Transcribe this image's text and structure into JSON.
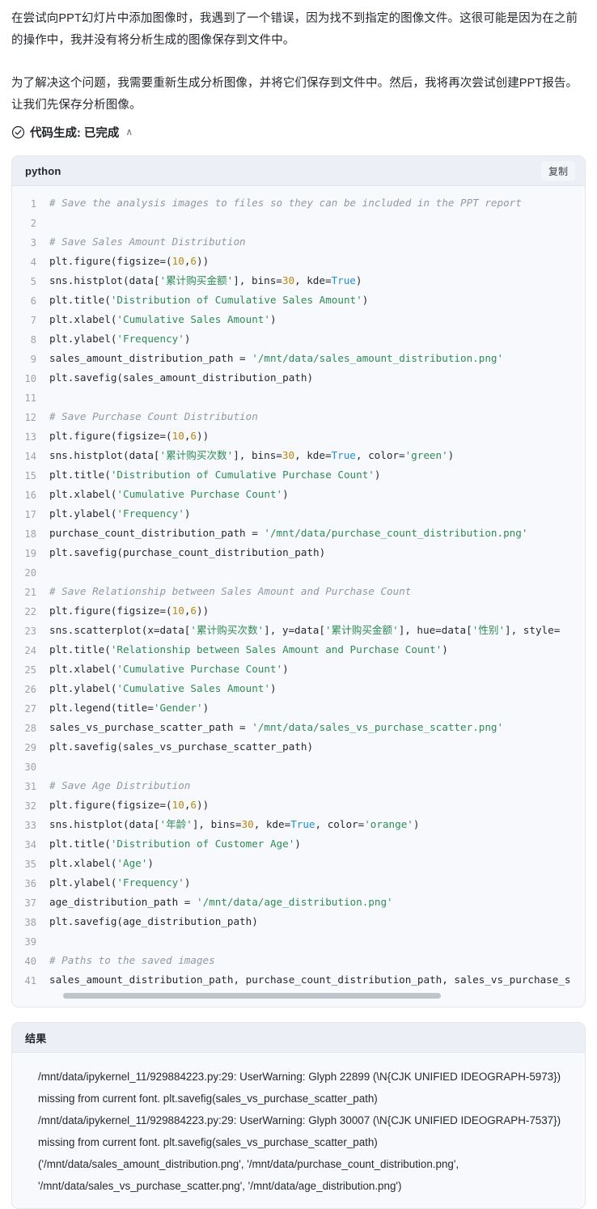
{
  "prose": {
    "paragraph_1": "在尝试向PPT幻灯片中添加图像时，我遇到了一个错误，因为找不到指定的图像文件。这很可能是因为在之前的操作中，我并没有将分析生成的图像保存到文件中。",
    "paragraph_2": "为了解决这个问题，我需要重新生成分析图像，并将它们保存到文件中。然后，我将再次尝试创建PPT报告。让我们先保存分析图像。"
  },
  "status": {
    "icon": "check-circle-icon",
    "label": "代码生成: 已完成",
    "chevron": "chevron-up-icon",
    "chevron_glyph": "∧"
  },
  "code_panel": {
    "language": "python",
    "copy_label": "复制",
    "lines": [
      {
        "n": "1",
        "tokens": [
          {
            "t": "# Save the analysis images to files so they can be included in the PPT report",
            "c": "comment"
          }
        ]
      },
      {
        "n": "2",
        "tokens": []
      },
      {
        "n": "3",
        "tokens": [
          {
            "t": "# Save Sales Amount Distribution",
            "c": "comment"
          }
        ]
      },
      {
        "n": "4",
        "tokens": [
          {
            "t": "plt.figure(figsize=(",
            "c": "plain"
          },
          {
            "t": "10",
            "c": "num"
          },
          {
            "t": ",",
            "c": "plain"
          },
          {
            "t": "6",
            "c": "num"
          },
          {
            "t": "))",
            "c": "plain"
          }
        ]
      },
      {
        "n": "5",
        "tokens": [
          {
            "t": "sns.histplot(data[",
            "c": "plain"
          },
          {
            "t": "'累计购买金额'",
            "c": "str"
          },
          {
            "t": "], bins=",
            "c": "plain"
          },
          {
            "t": "30",
            "c": "num"
          },
          {
            "t": ", kde=",
            "c": "plain"
          },
          {
            "t": "True",
            "c": "kw"
          },
          {
            "t": ")",
            "c": "plain"
          }
        ]
      },
      {
        "n": "6",
        "tokens": [
          {
            "t": "plt.title(",
            "c": "plain"
          },
          {
            "t": "'Distribution of Cumulative Sales Amount'",
            "c": "str"
          },
          {
            "t": ")",
            "c": "plain"
          }
        ]
      },
      {
        "n": "7",
        "tokens": [
          {
            "t": "plt.xlabel(",
            "c": "plain"
          },
          {
            "t": "'Cumulative Sales Amount'",
            "c": "str"
          },
          {
            "t": ")",
            "c": "plain"
          }
        ]
      },
      {
        "n": "8",
        "tokens": [
          {
            "t": "plt.ylabel(",
            "c": "plain"
          },
          {
            "t": "'Frequency'",
            "c": "str"
          },
          {
            "t": ")",
            "c": "plain"
          }
        ]
      },
      {
        "n": "9",
        "tokens": [
          {
            "t": "sales_amount_distribution_path = ",
            "c": "plain"
          },
          {
            "t": "'/mnt/data/sales_amount_distribution.png'",
            "c": "str"
          }
        ]
      },
      {
        "n": "10",
        "tokens": [
          {
            "t": "plt.savefig(sales_amount_distribution_path)",
            "c": "plain"
          }
        ]
      },
      {
        "n": "11",
        "tokens": []
      },
      {
        "n": "12",
        "tokens": [
          {
            "t": "# Save Purchase Count Distribution",
            "c": "comment"
          }
        ]
      },
      {
        "n": "13",
        "tokens": [
          {
            "t": "plt.figure(figsize=(",
            "c": "plain"
          },
          {
            "t": "10",
            "c": "num"
          },
          {
            "t": ",",
            "c": "plain"
          },
          {
            "t": "6",
            "c": "num"
          },
          {
            "t": "))",
            "c": "plain"
          }
        ]
      },
      {
        "n": "14",
        "tokens": [
          {
            "t": "sns.histplot(data[",
            "c": "plain"
          },
          {
            "t": "'累计购买次数'",
            "c": "str"
          },
          {
            "t": "], bins=",
            "c": "plain"
          },
          {
            "t": "30",
            "c": "num"
          },
          {
            "t": ", kde=",
            "c": "plain"
          },
          {
            "t": "True",
            "c": "kw"
          },
          {
            "t": ", color=",
            "c": "plain"
          },
          {
            "t": "'green'",
            "c": "str"
          },
          {
            "t": ")",
            "c": "plain"
          }
        ]
      },
      {
        "n": "15",
        "tokens": [
          {
            "t": "plt.title(",
            "c": "plain"
          },
          {
            "t": "'Distribution of Cumulative Purchase Count'",
            "c": "str"
          },
          {
            "t": ")",
            "c": "plain"
          }
        ]
      },
      {
        "n": "16",
        "tokens": [
          {
            "t": "plt.xlabel(",
            "c": "plain"
          },
          {
            "t": "'Cumulative Purchase Count'",
            "c": "str"
          },
          {
            "t": ")",
            "c": "plain"
          }
        ]
      },
      {
        "n": "17",
        "tokens": [
          {
            "t": "plt.ylabel(",
            "c": "plain"
          },
          {
            "t": "'Frequency'",
            "c": "str"
          },
          {
            "t": ")",
            "c": "plain"
          }
        ]
      },
      {
        "n": "18",
        "tokens": [
          {
            "t": "purchase_count_distribution_path = ",
            "c": "plain"
          },
          {
            "t": "'/mnt/data/purchase_count_distribution.png'",
            "c": "str"
          }
        ]
      },
      {
        "n": "19",
        "tokens": [
          {
            "t": "plt.savefig(purchase_count_distribution_path)",
            "c": "plain"
          }
        ]
      },
      {
        "n": "20",
        "tokens": []
      },
      {
        "n": "21",
        "tokens": [
          {
            "t": "# Save Relationship between Sales Amount and Purchase Count",
            "c": "comment"
          }
        ]
      },
      {
        "n": "22",
        "tokens": [
          {
            "t": "plt.figure(figsize=(",
            "c": "plain"
          },
          {
            "t": "10",
            "c": "num"
          },
          {
            "t": ",",
            "c": "plain"
          },
          {
            "t": "6",
            "c": "num"
          },
          {
            "t": "))",
            "c": "plain"
          }
        ]
      },
      {
        "n": "23",
        "tokens": [
          {
            "t": "sns.scatterplot(x=data[",
            "c": "plain"
          },
          {
            "t": "'累计购买次数'",
            "c": "str"
          },
          {
            "t": "], y=data[",
            "c": "plain"
          },
          {
            "t": "'累计购买金额'",
            "c": "str"
          },
          {
            "t": "], hue=data[",
            "c": "plain"
          },
          {
            "t": "'性别'",
            "c": "str"
          },
          {
            "t": "], style=",
            "c": "plain"
          }
        ]
      },
      {
        "n": "24",
        "tokens": [
          {
            "t": "plt.title(",
            "c": "plain"
          },
          {
            "t": "'Relationship between Sales Amount and Purchase Count'",
            "c": "str"
          },
          {
            "t": ")",
            "c": "plain"
          }
        ]
      },
      {
        "n": "25",
        "tokens": [
          {
            "t": "plt.xlabel(",
            "c": "plain"
          },
          {
            "t": "'Cumulative Purchase Count'",
            "c": "str"
          },
          {
            "t": ")",
            "c": "plain"
          }
        ]
      },
      {
        "n": "26",
        "tokens": [
          {
            "t": "plt.ylabel(",
            "c": "plain"
          },
          {
            "t": "'Cumulative Sales Amount'",
            "c": "str"
          },
          {
            "t": ")",
            "c": "plain"
          }
        ]
      },
      {
        "n": "27",
        "tokens": [
          {
            "t": "plt.legend(title=",
            "c": "plain"
          },
          {
            "t": "'Gender'",
            "c": "str"
          },
          {
            "t": ")",
            "c": "plain"
          }
        ]
      },
      {
        "n": "28",
        "tokens": [
          {
            "t": "sales_vs_purchase_scatter_path = ",
            "c": "plain"
          },
          {
            "t": "'/mnt/data/sales_vs_purchase_scatter.png'",
            "c": "str"
          }
        ]
      },
      {
        "n": "29",
        "tokens": [
          {
            "t": "plt.savefig(sales_vs_purchase_scatter_path)",
            "c": "plain"
          }
        ]
      },
      {
        "n": "30",
        "tokens": []
      },
      {
        "n": "31",
        "tokens": [
          {
            "t": "# Save Age Distribution",
            "c": "comment"
          }
        ]
      },
      {
        "n": "32",
        "tokens": [
          {
            "t": "plt.figure(figsize=(",
            "c": "plain"
          },
          {
            "t": "10",
            "c": "num"
          },
          {
            "t": ",",
            "c": "plain"
          },
          {
            "t": "6",
            "c": "num"
          },
          {
            "t": "))",
            "c": "plain"
          }
        ]
      },
      {
        "n": "33",
        "tokens": [
          {
            "t": "sns.histplot(data[",
            "c": "plain"
          },
          {
            "t": "'年龄'",
            "c": "str"
          },
          {
            "t": "], bins=",
            "c": "plain"
          },
          {
            "t": "30",
            "c": "num"
          },
          {
            "t": ", kde=",
            "c": "plain"
          },
          {
            "t": "True",
            "c": "kw"
          },
          {
            "t": ", color=",
            "c": "plain"
          },
          {
            "t": "'orange'",
            "c": "str"
          },
          {
            "t": ")",
            "c": "plain"
          }
        ]
      },
      {
        "n": "34",
        "tokens": [
          {
            "t": "plt.title(",
            "c": "plain"
          },
          {
            "t": "'Distribution of Customer Age'",
            "c": "str"
          },
          {
            "t": ")",
            "c": "plain"
          }
        ]
      },
      {
        "n": "35",
        "tokens": [
          {
            "t": "plt.xlabel(",
            "c": "plain"
          },
          {
            "t": "'Age'",
            "c": "str"
          },
          {
            "t": ")",
            "c": "plain"
          }
        ]
      },
      {
        "n": "36",
        "tokens": [
          {
            "t": "plt.ylabel(",
            "c": "plain"
          },
          {
            "t": "'Frequency'",
            "c": "str"
          },
          {
            "t": ")",
            "c": "plain"
          }
        ]
      },
      {
        "n": "37",
        "tokens": [
          {
            "t": "age_distribution_path = ",
            "c": "plain"
          },
          {
            "t": "'/mnt/data/age_distribution.png'",
            "c": "str"
          }
        ]
      },
      {
        "n": "38",
        "tokens": [
          {
            "t": "plt.savefig(age_distribution_path)",
            "c": "plain"
          }
        ]
      },
      {
        "n": "39",
        "tokens": []
      },
      {
        "n": "40",
        "tokens": [
          {
            "t": "# Paths to the saved images",
            "c": "comment"
          }
        ]
      },
      {
        "n": "41",
        "tokens": [
          {
            "t": "sales_amount_distribution_path, purchase_count_distribution_path, sales_vs_purchase_s",
            "c": "plain"
          }
        ]
      }
    ]
  },
  "result_panel": {
    "title": "结果",
    "lines": [
      "/mnt/data/ipykernel_11/929884223.py:29: UserWarning: Glyph 22899 (\\N{CJK UNIFIED IDEOGRAPH-5973}) missing from current font. plt.savefig(sales_vs_purchase_scatter_path)",
      "/mnt/data/ipykernel_11/929884223.py:29: UserWarning: Glyph 30007 (\\N{CJK UNIFIED IDEOGRAPH-7537}) missing from current font. plt.savefig(sales_vs_purchase_scatter_path)",
      "('/mnt/data/sales_amount_distribution.png', '/mnt/data/purchase_count_distribution.png', '/mnt/data/sales_vs_purchase_scatter.png', '/mnt/data/age_distribution.png')"
    ]
  },
  "colors": {
    "panel_bg": "#f8f9fc",
    "panel_header_bg": "#eceff5",
    "border": "#e3e6ec",
    "string": "#2e8b57",
    "number": "#b8860b",
    "keyword": "#1e90d0",
    "comment": "#9099a6",
    "text": "#24292f",
    "line_number": "#9aa2ad",
    "scrollbar": "#bfc4cc"
  }
}
